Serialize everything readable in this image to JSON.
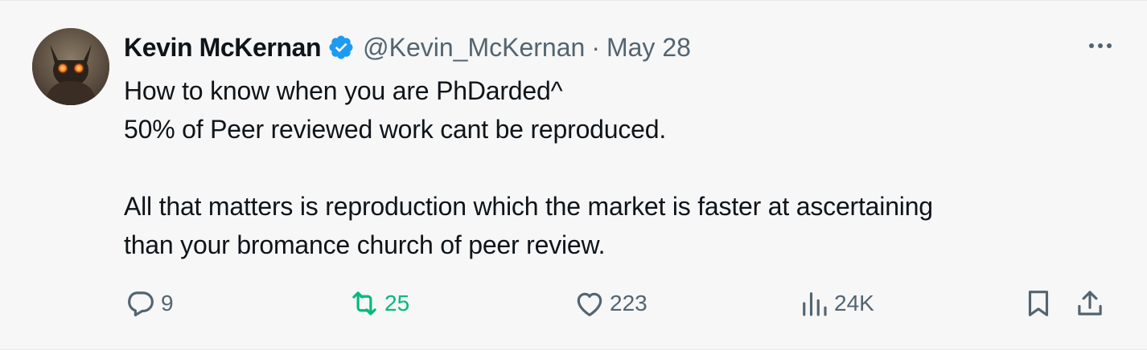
{
  "author": {
    "display_name": "Kevin McKernan",
    "handle": "@Kevin_McKernan",
    "separator": "·",
    "date": "May 28",
    "verified": true,
    "verified_color": "#1d9bf0"
  },
  "tweet": {
    "lines": [
      "How to know when you are PhDarded^",
      "50% of Peer reviewed work cant be reproduced.",
      "",
      "All that matters is reproduction which the market is faster at ascertaining",
      "than your bromance church of peer review."
    ]
  },
  "actions": {
    "reply": {
      "icon": "reply-icon",
      "count": "9"
    },
    "retweet": {
      "icon": "retweet-icon",
      "count": "25",
      "color": "#00ba7c"
    },
    "like": {
      "icon": "heart-icon",
      "count": "223"
    },
    "views": {
      "icon": "views-icon",
      "count": "24K"
    },
    "bookmark": {
      "icon": "bookmark-icon"
    },
    "share": {
      "icon": "share-icon"
    }
  },
  "more": {
    "icon": "more-dots-icon"
  },
  "colors": {
    "text": "#0f1419",
    "secondary": "#536471",
    "background": "#f7f7f7"
  }
}
